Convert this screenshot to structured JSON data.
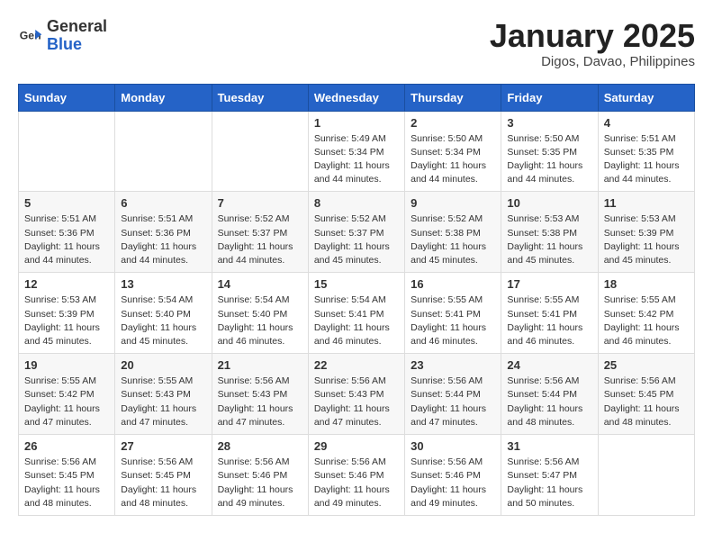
{
  "header": {
    "logo_general": "General",
    "logo_blue": "Blue",
    "month_title": "January 2025",
    "location": "Digos, Davao, Philippines"
  },
  "weekdays": [
    "Sunday",
    "Monday",
    "Tuesday",
    "Wednesday",
    "Thursday",
    "Friday",
    "Saturday"
  ],
  "weeks": [
    [
      null,
      null,
      null,
      {
        "day": 1,
        "sunrise": "5:49 AM",
        "sunset": "5:34 PM",
        "daylight": "11 hours and 44 minutes."
      },
      {
        "day": 2,
        "sunrise": "5:50 AM",
        "sunset": "5:34 PM",
        "daylight": "11 hours and 44 minutes."
      },
      {
        "day": 3,
        "sunrise": "5:50 AM",
        "sunset": "5:35 PM",
        "daylight": "11 hours and 44 minutes."
      },
      {
        "day": 4,
        "sunrise": "5:51 AM",
        "sunset": "5:35 PM",
        "daylight": "11 hours and 44 minutes."
      }
    ],
    [
      {
        "day": 5,
        "sunrise": "5:51 AM",
        "sunset": "5:36 PM",
        "daylight": "11 hours and 44 minutes."
      },
      {
        "day": 6,
        "sunrise": "5:51 AM",
        "sunset": "5:36 PM",
        "daylight": "11 hours and 44 minutes."
      },
      {
        "day": 7,
        "sunrise": "5:52 AM",
        "sunset": "5:37 PM",
        "daylight": "11 hours and 44 minutes."
      },
      {
        "day": 8,
        "sunrise": "5:52 AM",
        "sunset": "5:37 PM",
        "daylight": "11 hours and 45 minutes."
      },
      {
        "day": 9,
        "sunrise": "5:52 AM",
        "sunset": "5:38 PM",
        "daylight": "11 hours and 45 minutes."
      },
      {
        "day": 10,
        "sunrise": "5:53 AM",
        "sunset": "5:38 PM",
        "daylight": "11 hours and 45 minutes."
      },
      {
        "day": 11,
        "sunrise": "5:53 AM",
        "sunset": "5:39 PM",
        "daylight": "11 hours and 45 minutes."
      }
    ],
    [
      {
        "day": 12,
        "sunrise": "5:53 AM",
        "sunset": "5:39 PM",
        "daylight": "11 hours and 45 minutes."
      },
      {
        "day": 13,
        "sunrise": "5:54 AM",
        "sunset": "5:40 PM",
        "daylight": "11 hours and 45 minutes."
      },
      {
        "day": 14,
        "sunrise": "5:54 AM",
        "sunset": "5:40 PM",
        "daylight": "11 hours and 46 minutes."
      },
      {
        "day": 15,
        "sunrise": "5:54 AM",
        "sunset": "5:41 PM",
        "daylight": "11 hours and 46 minutes."
      },
      {
        "day": 16,
        "sunrise": "5:55 AM",
        "sunset": "5:41 PM",
        "daylight": "11 hours and 46 minutes."
      },
      {
        "day": 17,
        "sunrise": "5:55 AM",
        "sunset": "5:41 PM",
        "daylight": "11 hours and 46 minutes."
      },
      {
        "day": 18,
        "sunrise": "5:55 AM",
        "sunset": "5:42 PM",
        "daylight": "11 hours and 46 minutes."
      }
    ],
    [
      {
        "day": 19,
        "sunrise": "5:55 AM",
        "sunset": "5:42 PM",
        "daylight": "11 hours and 47 minutes."
      },
      {
        "day": 20,
        "sunrise": "5:55 AM",
        "sunset": "5:43 PM",
        "daylight": "11 hours and 47 minutes."
      },
      {
        "day": 21,
        "sunrise": "5:56 AM",
        "sunset": "5:43 PM",
        "daylight": "11 hours and 47 minutes."
      },
      {
        "day": 22,
        "sunrise": "5:56 AM",
        "sunset": "5:43 PM",
        "daylight": "11 hours and 47 minutes."
      },
      {
        "day": 23,
        "sunrise": "5:56 AM",
        "sunset": "5:44 PM",
        "daylight": "11 hours and 47 minutes."
      },
      {
        "day": 24,
        "sunrise": "5:56 AM",
        "sunset": "5:44 PM",
        "daylight": "11 hours and 48 minutes."
      },
      {
        "day": 25,
        "sunrise": "5:56 AM",
        "sunset": "5:45 PM",
        "daylight": "11 hours and 48 minutes."
      }
    ],
    [
      {
        "day": 26,
        "sunrise": "5:56 AM",
        "sunset": "5:45 PM",
        "daylight": "11 hours and 48 minutes."
      },
      {
        "day": 27,
        "sunrise": "5:56 AM",
        "sunset": "5:45 PM",
        "daylight": "11 hours and 48 minutes."
      },
      {
        "day": 28,
        "sunrise": "5:56 AM",
        "sunset": "5:46 PM",
        "daylight": "11 hours and 49 minutes."
      },
      {
        "day": 29,
        "sunrise": "5:56 AM",
        "sunset": "5:46 PM",
        "daylight": "11 hours and 49 minutes."
      },
      {
        "day": 30,
        "sunrise": "5:56 AM",
        "sunset": "5:46 PM",
        "daylight": "11 hours and 49 minutes."
      },
      {
        "day": 31,
        "sunrise": "5:56 AM",
        "sunset": "5:47 PM",
        "daylight": "11 hours and 50 minutes."
      },
      null
    ]
  ],
  "labels": {
    "sunrise_prefix": "Sunrise: ",
    "sunset_prefix": "Sunset: ",
    "daylight_prefix": "Daylight: "
  }
}
